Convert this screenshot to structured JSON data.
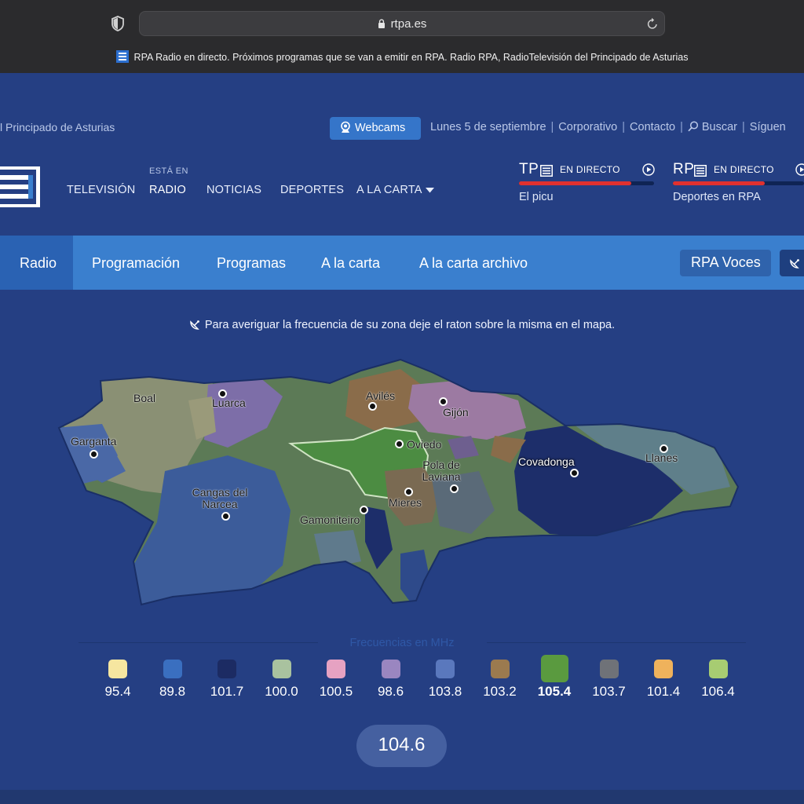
{
  "browser": {
    "url": "rtpa.es",
    "tab_title": "RPA Radio en directo. Próximos programas que se van a emitir en RPA. Radio RPA, RadioTelevisión del Principado de Asturias"
  },
  "header": {
    "site_tagline": "l Principado de Asturias",
    "webcams_label": "Webcams",
    "date": "Lunes 5 de septiembre",
    "links": [
      "Corporativo",
      "Contacto",
      "Buscar",
      "Síguen"
    ]
  },
  "mainnav": {
    "esta_en": "ESTÁ EN",
    "items": [
      "TELEVISIÓN",
      "RADIO",
      "NOTICIAS",
      "DEPORTES",
      "A LA CARTA"
    ]
  },
  "live": [
    {
      "brand": "TP",
      "label": "EN DIRECTO",
      "program": "El picu",
      "progress": 0.83
    },
    {
      "brand": "RP",
      "label": "EN DIRECTO",
      "program": "Deportes en RPA",
      "progress": 0.7
    }
  ],
  "subnav": {
    "items": [
      "Radio",
      "Programación",
      "Programas",
      "A la carta",
      "A la carta archivo"
    ],
    "active": "Radio",
    "voces": "RPA Voces"
  },
  "hint": "Para averiguar la frecuencia de su zona deje el raton sobre la misma en el mapa.",
  "map": {
    "places": [
      {
        "name": "Boal"
      },
      {
        "name": "Luarca"
      },
      {
        "name": "Garganta"
      },
      {
        "name": "Avilés"
      },
      {
        "name": "Gijón"
      },
      {
        "name": "Oviedo"
      },
      {
        "name": "Pola de Laviana"
      },
      {
        "name": "Covadonga"
      },
      {
        "name": "Llanes"
      },
      {
        "name": "Cangas del Narcea"
      },
      {
        "name": "Mieres"
      },
      {
        "name": "Gamoniteiro"
      }
    ]
  },
  "legend": {
    "title": "Frecuencias en MHz",
    "items": [
      {
        "freq": "95.4",
        "color": "#f6e6a0"
      },
      {
        "freq": "89.8",
        "color": "#3a6fc0"
      },
      {
        "freq": "101.7",
        "color": "#1c2b63"
      },
      {
        "freq": "100.0",
        "color": "#a9c29f"
      },
      {
        "freq": "100.5",
        "color": "#e6a2c2"
      },
      {
        "freq": "98.6",
        "color": "#9a86c0"
      },
      {
        "freq": "103.8",
        "color": "#5a78bd"
      },
      {
        "freq": "103.2",
        "color": "#9b7a4f"
      },
      {
        "freq": "105.4",
        "color": "#5a9a3f",
        "selected": true
      },
      {
        "freq": "103.7",
        "color": "#6f7278"
      },
      {
        "freq": "101.4",
        "color": "#efb25c"
      },
      {
        "freq": "106.4",
        "color": "#a7cc72"
      }
    ]
  },
  "current_freq": "104.6"
}
